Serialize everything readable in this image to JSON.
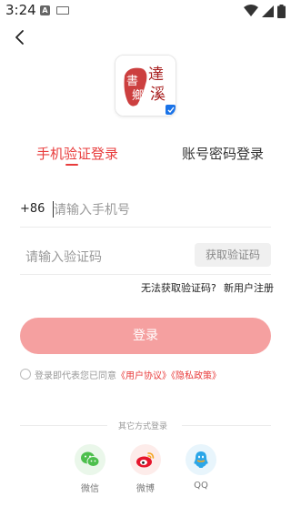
{
  "status_bar": {
    "time": "3:24",
    "notification_letter": "A"
  },
  "logo": {
    "chars_red_left": "書",
    "chars_red_left2": "鄉",
    "chars_red_right": "達",
    "chars_red_right2": "溪"
  },
  "tabs": [
    {
      "label": "手机验证登录",
      "active": true
    },
    {
      "label": "账号密码登录",
      "active": false
    }
  ],
  "phone": {
    "country_code": "+86",
    "placeholder": "请输入手机号",
    "value": ""
  },
  "code": {
    "placeholder": "请输入验证码",
    "value": "",
    "get_code_label": "获取验证码"
  },
  "links": {
    "no_code": "无法获取验证码?",
    "register": "新用户注册"
  },
  "login_button": "登录",
  "agreement": {
    "prefix": "登录即代表您已同意",
    "user_agreement": "《用户协议》",
    "privacy_policy": "《隐私政策》"
  },
  "other_methods": {
    "title": "其它方式登录",
    "items": [
      {
        "label": "微信",
        "icon": "wechat-icon",
        "color": "#4cbf4c"
      },
      {
        "label": "微博",
        "icon": "weibo-icon",
        "color": "#e6162d"
      },
      {
        "label": "QQ",
        "icon": "qq-icon",
        "color": "#2ba6e8"
      }
    ]
  },
  "colors": {
    "accent": "#e83c3c",
    "login_button_bg": "#f5a0a0"
  }
}
